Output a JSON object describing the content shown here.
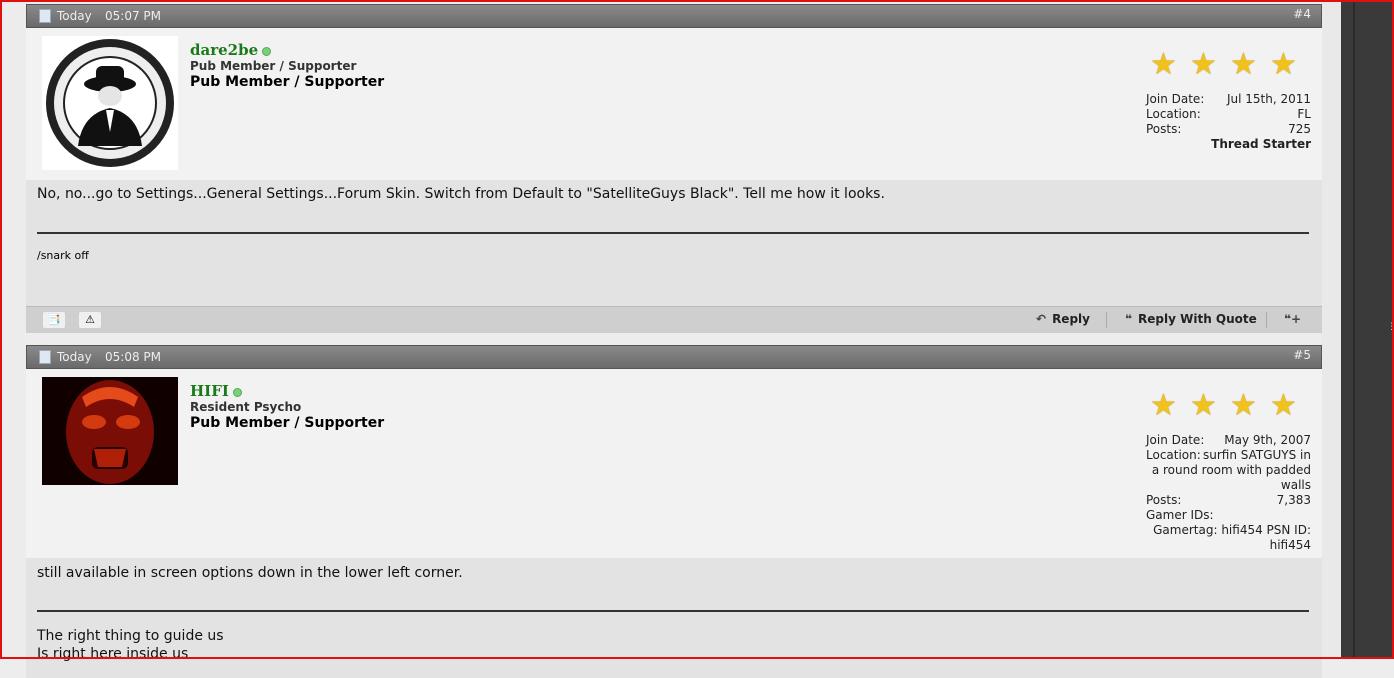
{
  "posts": [
    {
      "date": "Today",
      "time": "05:07 PM",
      "number": "#4",
      "username": "dare2be",
      "user_title": "Pub Member / Supporter",
      "user_rank": "Pub Member / Supporter",
      "stats": {
        "join_date_label": "Join Date:",
        "join_date": "Jul 15th, 2011",
        "location_label": "Location:",
        "location": "FL",
        "posts_label": "Posts:",
        "posts": "725",
        "badge": "Thread Starter"
      },
      "message": "No, no...go to Settings...General Settings...Forum Skin. Switch from Default to \"SatelliteGuys Black\". Tell me how it looks.",
      "signature": "/snark off",
      "actions": {
        "reply": "Reply",
        "reply_with_quote": "Reply With Quote"
      },
      "icons": [
        "blog-icon",
        "report-icon",
        "multiquote-icon"
      ]
    },
    {
      "date": "Today",
      "time": "05:08 PM",
      "number": "#5",
      "username": "HIFI",
      "user_title": "Resident Psycho",
      "user_rank": "Pub Member / Supporter",
      "stats": {
        "join_date_label": "Join Date:",
        "join_date": "May 9th, 2007",
        "location_label": "Location:",
        "location_line1": "surfin SATGUYS in",
        "location_line2": "a round room with padded",
        "location_line3": "walls",
        "posts_label": "Posts:",
        "posts": "7,383",
        "gamer_label": "Gamer IDs:",
        "gamer_line1": "Gamertag: hifi454 PSN ID:",
        "gamer_line2": "hifi454"
      },
      "message": "still available in screen options down in the lower left corner.",
      "signature_line1": "The right thing to guide us",
      "signature_line2": "Is right here inside us"
    }
  ],
  "colors": {
    "username": "#1a7a1a",
    "star": "#f1c21b",
    "frame": "#e01010"
  }
}
